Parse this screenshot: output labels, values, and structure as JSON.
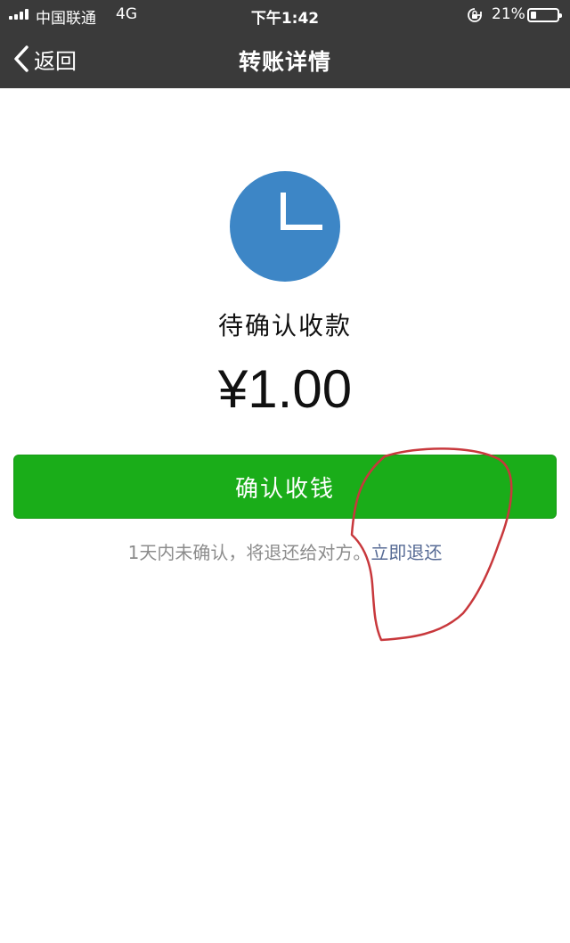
{
  "status_bar": {
    "carrier": "中国联通",
    "network": "4G",
    "time": "下午1:42",
    "battery_percent": "21%",
    "battery_level": 0.21
  },
  "nav": {
    "back_label": "返回",
    "title": "转账详情"
  },
  "transfer": {
    "status": "待确认收款",
    "amount": "¥1.00",
    "confirm_button": "确认收钱",
    "note_prefix": "1天内未确认，将退还给对方。",
    "refund_link": "立即退还"
  },
  "icons": {
    "back": "chevron-left-icon",
    "clock": "clock-icon",
    "rotation_lock": "rotation-lock-icon",
    "battery": "battery-icon",
    "signal": "signal-icon"
  },
  "colors": {
    "nav_background": "#3a3a3a",
    "clock_circle": "#3d86c6",
    "confirm_button": "#1aad19",
    "link": "#576b95",
    "annotation": "#c8383c"
  }
}
